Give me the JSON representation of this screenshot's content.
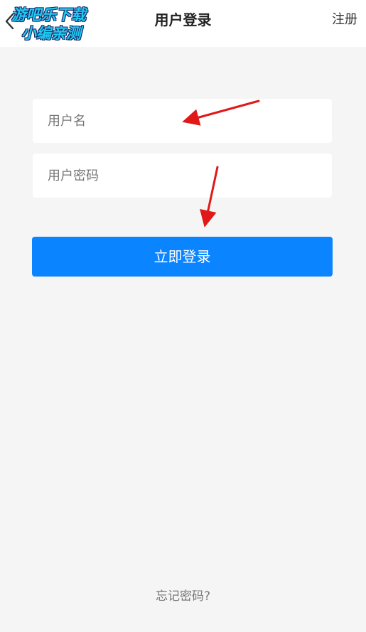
{
  "header": {
    "title": "用户登录",
    "register_label": "注册",
    "back_icon": "chevron-left-icon"
  },
  "watermark": {
    "line1": "游吧乐下载",
    "line2": "小编亲测",
    "color": "#20c9f0"
  },
  "form": {
    "username_placeholder": "用户名",
    "username_value": "",
    "password_placeholder": "用户密码",
    "password_value": "",
    "submit_label": "立即登录"
  },
  "footer": {
    "forgot_label": "忘记密码?"
  },
  "colors": {
    "accent": "#0a84ff",
    "background": "#f5f5f5",
    "annotation_arrow": "#e01818"
  },
  "annotations": {
    "arrows": [
      "red-arrow-icon",
      "red-arrow-icon"
    ]
  }
}
